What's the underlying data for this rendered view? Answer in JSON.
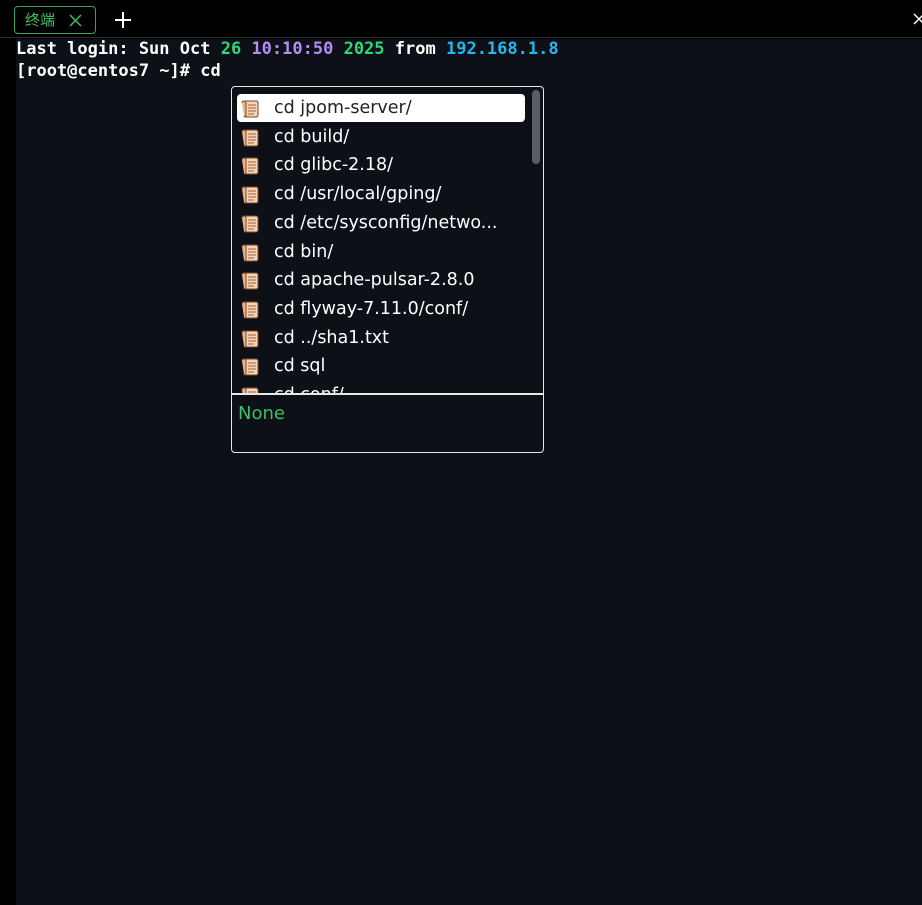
{
  "tabbar": {
    "tab_label": "终端",
    "tab_close_icon": "close-icon",
    "add_icon": "plus-icon",
    "window_close_icon": "close-icon"
  },
  "terminal": {
    "login_line": {
      "prefix": "Last login: Sun Oct ",
      "day": "26",
      "time": "10:10:50",
      "year": "2025",
      "from": "from",
      "ip": "192.168.1.8"
    },
    "prompt": "[root@centos7 ~]# ",
    "command": "cd"
  },
  "colors": {
    "number_green": "#2fd67a",
    "time_purple": "#b38cf5",
    "ip_cyan": "#27b6ea",
    "tab_green": "#3fbf63"
  },
  "autocomplete": {
    "item_icon": "scroll-icon",
    "items": [
      "cd jpom-server/",
      "cd build/",
      "cd glibc-2.18/",
      "cd /usr/local/gping/",
      "cd /etc/sysconfig/netwo...",
      "cd bin/",
      "cd apache-pulsar-2.8.0",
      "cd flyway-7.11.0/conf/",
      "cd ../sha1.txt",
      "cd sql",
      "cd conf/"
    ],
    "selected_index": 0,
    "detail_text": "None"
  }
}
